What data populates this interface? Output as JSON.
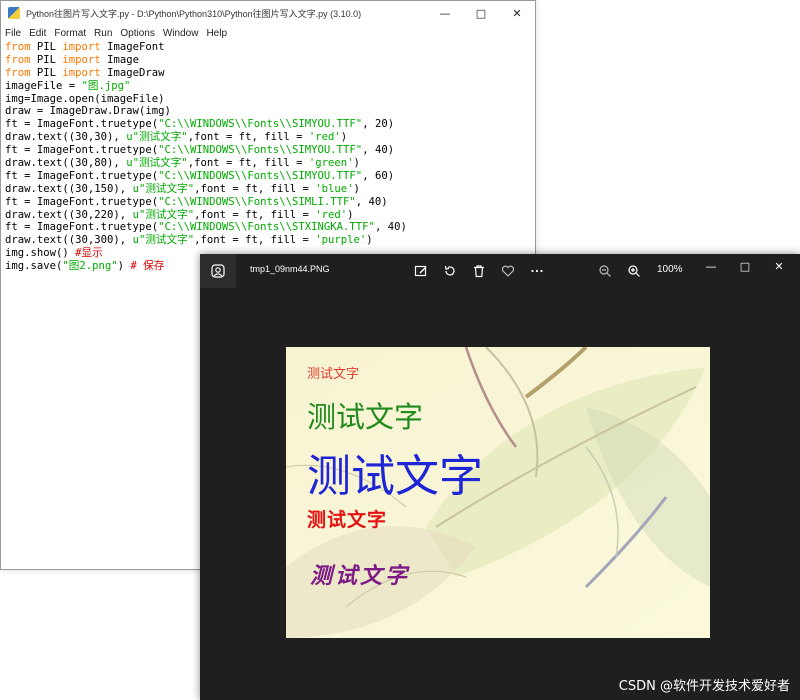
{
  "editor": {
    "title": "Python往图片写入文字.py - D:\\Python\\Python310\\Python往图片写入文字.py (3.10.0)",
    "menus": [
      "File",
      "Edit",
      "Format",
      "Run",
      "Options",
      "Window",
      "Help"
    ],
    "code_lines": [
      [
        {
          "t": "from",
          "c": "kw"
        },
        {
          "t": " PIL ",
          "c": ""
        },
        {
          "t": "import",
          "c": "kw"
        },
        {
          "t": " ImageFont",
          "c": ""
        }
      ],
      [
        {
          "t": "from",
          "c": "kw"
        },
        {
          "t": " PIL ",
          "c": ""
        },
        {
          "t": "import",
          "c": "kw"
        },
        {
          "t": " Image",
          "c": ""
        }
      ],
      [
        {
          "t": "from",
          "c": "kw"
        },
        {
          "t": " PIL ",
          "c": ""
        },
        {
          "t": "import",
          "c": "kw"
        },
        {
          "t": " ImageDraw",
          "c": ""
        }
      ],
      [
        {
          "t": "imageFile = ",
          "c": ""
        },
        {
          "t": "\"图.jpg\"",
          "c": "str"
        }
      ],
      [
        {
          "t": "img=Image.open(imageFile)",
          "c": ""
        }
      ],
      [
        {
          "t": "draw = ImageDraw.Draw(img)",
          "c": ""
        }
      ],
      [
        {
          "t": "ft = ImageFont.truetype(",
          "c": ""
        },
        {
          "t": "\"C:\\\\WINDOWS\\\\Fonts\\\\SIMYOU.TTF\"",
          "c": "str"
        },
        {
          "t": ", 20)",
          "c": ""
        }
      ],
      [
        {
          "t": "draw.text((30,30), ",
          "c": ""
        },
        {
          "t": "u\"测试文字\"",
          "c": "str"
        },
        {
          "t": ",font = ft, fill = ",
          "c": ""
        },
        {
          "t": "'red'",
          "c": "str"
        },
        {
          "t": ")",
          "c": ""
        }
      ],
      [
        {
          "t": "ft = ImageFont.truetype(",
          "c": ""
        },
        {
          "t": "\"C:\\\\WINDOWS\\\\Fonts\\\\SIMYOU.TTF\"",
          "c": "str"
        },
        {
          "t": ", 40)",
          "c": ""
        }
      ],
      [
        {
          "t": "draw.text((30,80), ",
          "c": ""
        },
        {
          "t": "u\"测试文字\"",
          "c": "str"
        },
        {
          "t": ",font = ft, fill = ",
          "c": ""
        },
        {
          "t": "'green'",
          "c": "str"
        },
        {
          "t": ")",
          "c": ""
        }
      ],
      [
        {
          "t": "ft = ImageFont.truetype(",
          "c": ""
        },
        {
          "t": "\"C:\\\\WINDOWS\\\\Fonts\\\\SIMYOU.TTF\"",
          "c": "str"
        },
        {
          "t": ", 60)",
          "c": ""
        }
      ],
      [
        {
          "t": "draw.text((30,150), ",
          "c": ""
        },
        {
          "t": "u\"测试文字\"",
          "c": "str"
        },
        {
          "t": ",font = ft, fill = ",
          "c": ""
        },
        {
          "t": "'blue'",
          "c": "str"
        },
        {
          "t": ")",
          "c": ""
        }
      ],
      [
        {
          "t": "ft = ImageFont.truetype(",
          "c": ""
        },
        {
          "t": "\"C:\\\\WINDOWS\\\\Fonts\\\\SIMLI.TTF\"",
          "c": "str"
        },
        {
          "t": ", 40)",
          "c": ""
        }
      ],
      [
        {
          "t": "draw.text((30,220), ",
          "c": ""
        },
        {
          "t": "u\"测试文字\"",
          "c": "str"
        },
        {
          "t": ",font = ft, fill = ",
          "c": ""
        },
        {
          "t": "'red'",
          "c": "str"
        },
        {
          "t": ")",
          "c": ""
        }
      ],
      [
        {
          "t": "ft = ImageFont.truetype(",
          "c": ""
        },
        {
          "t": "\"C:\\\\WINDOWS\\\\Fonts\\\\STXINGKA.TTF\"",
          "c": "str"
        },
        {
          "t": ", 40)",
          "c": ""
        }
      ],
      [
        {
          "t": "draw.text((30,300), ",
          "c": ""
        },
        {
          "t": "u\"测试文字\"",
          "c": "str"
        },
        {
          "t": ",font = ft, fill = ",
          "c": ""
        },
        {
          "t": "'purple'",
          "c": "str"
        },
        {
          "t": ")",
          "c": ""
        }
      ],
      [
        {
          "t": "img.show() ",
          "c": ""
        },
        {
          "t": "#显示",
          "c": "cmt"
        }
      ],
      [
        {
          "t": "img.save(",
          "c": ""
        },
        {
          "t": "\"图2.png\"",
          "c": "str"
        },
        {
          "t": ") ",
          "c": ""
        },
        {
          "t": "# 保存",
          "c": "cmt"
        }
      ]
    ]
  },
  "viewer": {
    "filename": "tmp1_09nm44.PNG",
    "zoom": "100%",
    "image_texts": [
      "测试文字",
      "测试文字",
      "测试文字",
      "测试文字",
      "测试文字"
    ]
  },
  "watermark": "CSDN @软件开发技术爱好者",
  "colors": {
    "keyword": "#ff7700",
    "string": "#00aa00",
    "comment": "#dd0000",
    "viewer_bg": "#1f1f1f",
    "red": "#e33a2c",
    "green": "#1f8b1f",
    "blue": "#1d25d6",
    "purple": "#7d1a86"
  }
}
